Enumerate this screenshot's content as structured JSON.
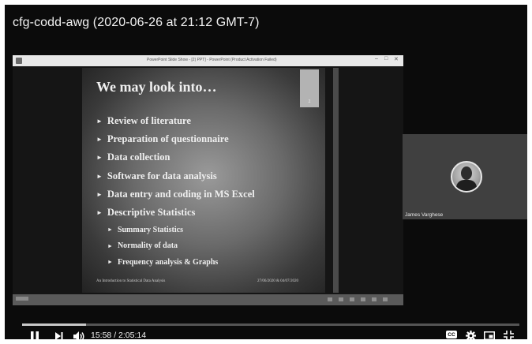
{
  "video": {
    "title": "cfg-codd-awg (2020-06-26 at 21:12 GMT-7)"
  },
  "ppt_window": {
    "title": "PowerPoint Slide Show - [2) PPT] - PowerPoint (Product Activation Failed)",
    "controls": {
      "minimize": "–",
      "restore": "□",
      "close": "✕"
    }
  },
  "slide": {
    "number": "2",
    "title": "We may look into…",
    "bullets": [
      {
        "level": 1,
        "text": "Review of literature"
      },
      {
        "level": 1,
        "text": "Preparation of questionnaire"
      },
      {
        "level": 1,
        "text": "Data collection"
      },
      {
        "level": 1,
        "text": "Software for data analysis"
      },
      {
        "level": 1,
        "text": "Data entry and coding in MS Excel"
      },
      {
        "level": 1,
        "text": "Descriptive Statistics"
      },
      {
        "level": 2,
        "text": "Summary Statistics"
      },
      {
        "level": 2,
        "text": "Normality of data"
      },
      {
        "level": 2,
        "text": "Frequency analysis & Graphs"
      }
    ],
    "bullet_marker": "►",
    "footer_left": "An Introduction to Statistical Data Analysis",
    "footer_right": "27/06/2020 & 04/07/2020"
  },
  "participant": {
    "name": "James Varghese"
  },
  "player": {
    "time_display": "15:58 / 2:05:14",
    "progress": 0.128,
    "icons": {
      "pause": "pause-icon",
      "next": "next-icon",
      "volume": "volume-icon",
      "captions": "captions-icon",
      "settings": "settings-icon",
      "miniplayer": "miniplayer-icon",
      "exit_fullscreen": "exit-fullscreen-icon"
    },
    "cc_label": "CC"
  }
}
